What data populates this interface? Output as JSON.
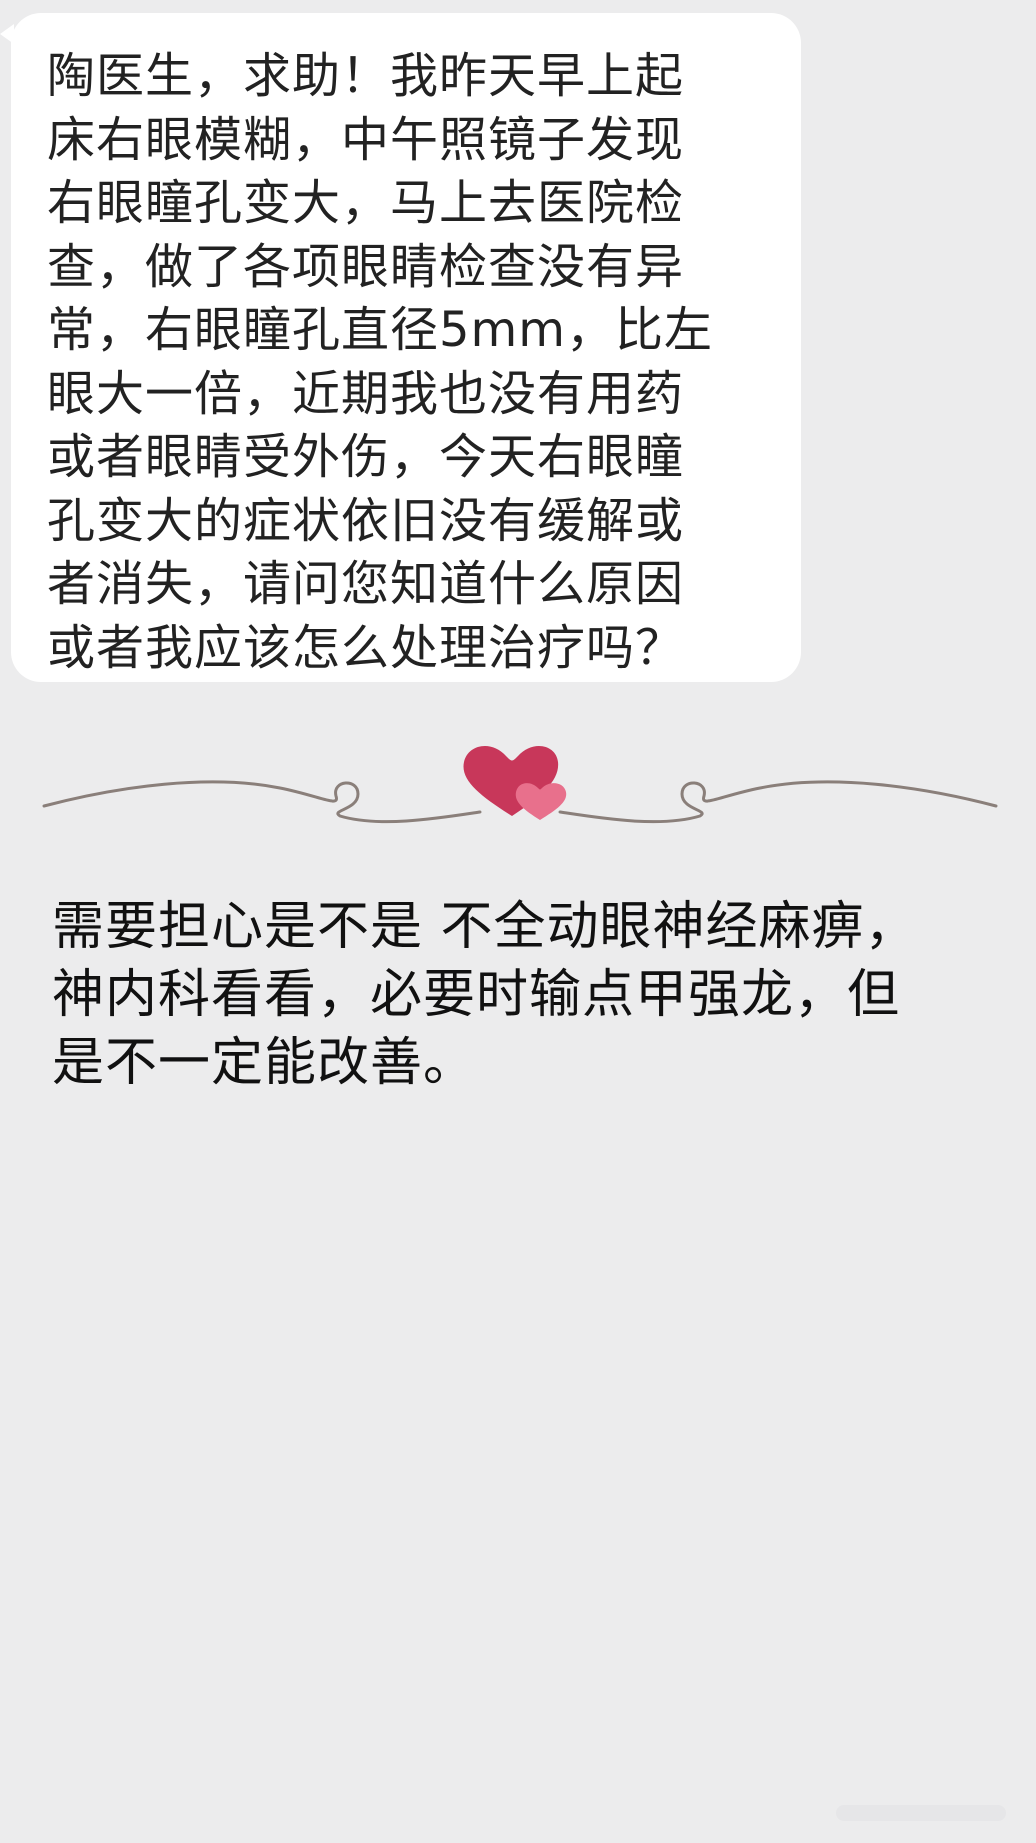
{
  "question": {
    "lines": [
      "陶医生，求助！我昨天早上起",
      "床右眼模糊，中午照镜子发现",
      "右眼瞳孔变大，马上去医院检",
      "查，做了各项眼睛检查没有异",
      "常，右眼瞳孔直径5mm，比左",
      "眼大一倍，近期我也没有用药",
      "或者眼睛受外伤，今天右眼瞳",
      "孔变大的症状依旧没有缓解或",
      "者消失，请问您知道什么原因",
      "或者我应该怎么处理治疗吗？"
    ]
  },
  "divider": {
    "icon": "heart-divider-icon",
    "heart_color": "#c8375a",
    "small_heart_color": "#e8708c",
    "line_color": "#8a7f7a"
  },
  "answer": {
    "lines": [
      "需要担心是不是 不全动眼神经麻痹，",
      "神内科看看，必要时输点甲强龙，但",
      "是不一定能改善。"
    ]
  },
  "colors": {
    "background": "#ececed",
    "bubble": "#ffffff",
    "text": "#222222"
  }
}
